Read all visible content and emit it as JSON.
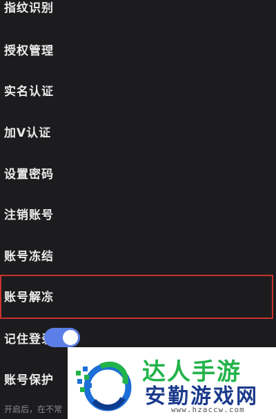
{
  "settings": {
    "items": [
      {
        "label": "指纹识别"
      },
      {
        "label": "授权管理"
      },
      {
        "label": "实名认证"
      },
      {
        "label": "加V认证"
      },
      {
        "label": "设置密码"
      },
      {
        "label": "注销账号"
      },
      {
        "label": "账号冻结"
      },
      {
        "label": "账号解冻",
        "highlighted": true
      },
      {
        "label": "记住登录信息",
        "toggle": "on"
      },
      {
        "label": "账号保护"
      }
    ],
    "footnote": "开启后，在不常",
    "chevron_icon": "chevron-right-icon"
  },
  "watermark": {
    "top_text": "达人手游",
    "main_text": "安勤游戏网",
    "url": "www.hzaccw.com"
  },
  "colors": {
    "background": "#1c1c1e",
    "highlight_border": "#c8322f",
    "toggle_on": "#5b7fe6"
  }
}
